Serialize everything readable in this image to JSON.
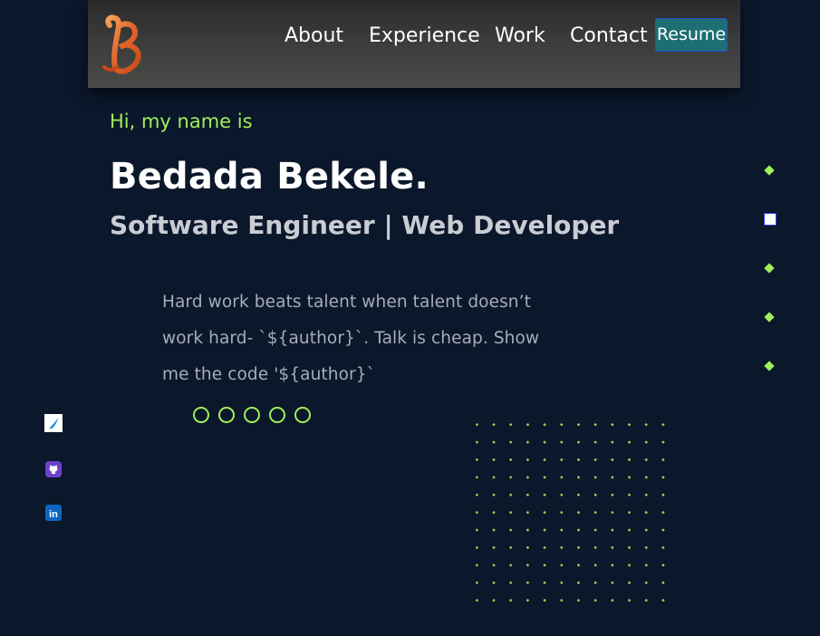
{
  "nav": {
    "logo_alt": "B",
    "links": [
      "About",
      "Experience",
      "Work",
      "Contact"
    ],
    "resume_label": "Resume"
  },
  "hero": {
    "greeting": "Hi, my name is",
    "name": "Bedada Bekele.",
    "subtitle": "Software Engineer | Web Developer",
    "quote": "Hard work beats talent when talent doesn’t work hard- `${author}`. Talk is cheap. Show me the code '${author}`"
  },
  "carousel": {
    "dot_count": 5
  },
  "side_nav": {
    "item_count": 5,
    "active_index": 1
  },
  "social": {
    "icons": [
      "bluesky-icon",
      "github-icon",
      "linkedin-icon"
    ],
    "linkedin_text": "in"
  },
  "colors": {
    "accent": "#9ff05a",
    "background": "#0b172a",
    "resume_bg": "#1d6f73"
  }
}
